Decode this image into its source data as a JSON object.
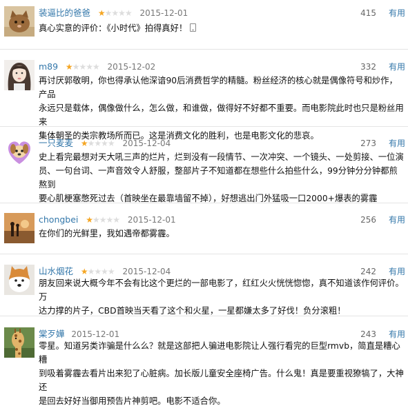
{
  "useful_label": "有用",
  "colors": {
    "link": "#3377aa",
    "star_on": "#f5a623",
    "star_off": "#dddddd",
    "divider": "#e4e4e4"
  },
  "reviews": [
    {
      "username": "装逼比的爸爸",
      "rating": 1,
      "date": "2015-12-01",
      "votes": "415",
      "lines": [
        "真心实意的评价：《小时代》拍得真好！"
      ],
      "trailing_icon": "mobile-phone-icon",
      "avatar": "brown-cat-avatar"
    },
    {
      "username": "m89",
      "rating": 1,
      "date": "2015-12-02",
      "votes": "332",
      "lines": [
        "再讨厌郭敬明，你也得承认他深谙90后消费哲学的精髓。粉丝经济的核心就是偶像符号和炒作，产品",
        "永远只是载体，偶像做什么，怎么做，和谁做，做得好不好都不重要。而电影院此时也只是粉丝用来",
        "集体朝圣的类宗教场所而已。这是消费文化的胜利，也是电影文化的悲哀。"
      ],
      "avatar": "girl-portrait-avatar"
    },
    {
      "username": "一只麦麦",
      "rating": 1,
      "date": "2015-12-04",
      "votes": "273",
      "lines": [
        "史上看完最想对天大吼三声的烂片，烂到没有一段情节、一次冲突、一个镜头、一处剪接、一位演",
        "员、一句台词、一声音效令人舒服，整部片子不知道都在想些什么拍些什么，99分钟分分钟都煎熬到",
        "要心肌梗塞憋死过去（首映坐在最靠墙留不掉），好想逃出门外猛吸一口2000+爆表的雾霾"
      ],
      "avatar": "cartoon-dog-heart-avatar"
    },
    {
      "username": "chongbei",
      "rating": 1,
      "date": "2015-12-01",
      "votes": "256",
      "lines": [
        "在你们的光鲜里，我如遇帝都雾霾。"
      ],
      "avatar": "sunset-silhouette-avatar"
    },
    {
      "username": "山水烟花",
      "rating": 1,
      "date": "2015-12-04",
      "votes": "242",
      "lines": [
        "朋友回来说大概今年不会有比这个更烂的一部电影了，红红火火恍恍惚惚，真不知道该作何评价。万",
        "达力撑的片子，CBD首映当天看了这个和火星，一星都嫌太多了好伐！负分滚粗！"
      ],
      "avatar": "shiba-dog-avatar"
    },
    {
      "username": "棠歹嬅",
      "rating": 0,
      "date": "2015-12-01",
      "votes": "243",
      "lines": [
        "零星。知道另类诈骗是什么么？就是这部把人骗进电影院让人强行看完的巨型rmvb，简直是糟心糟",
        "到吸着雾霾去看片出来犯了心脏病。加长版儿童安全座椅广告。什么鬼！真是要重视獠犒了，大神还",
        "是回去好好当御用预告片神剪吧。电影不适合你。"
      ],
      "avatar": "giraffe-avatar"
    }
  ]
}
